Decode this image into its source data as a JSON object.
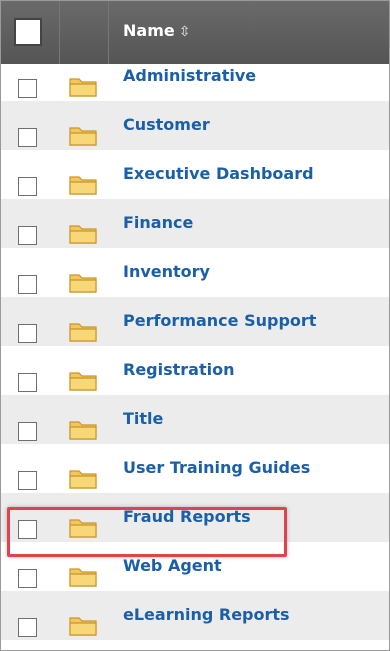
{
  "header": {
    "name_label": "Name",
    "sort_symbol": "⇳"
  },
  "folders": [
    {
      "label": "Administrative"
    },
    {
      "label": "Customer"
    },
    {
      "label": "Executive Dashboard"
    },
    {
      "label": "Finance"
    },
    {
      "label": "Inventory"
    },
    {
      "label": "Performance Support"
    },
    {
      "label": "Registration"
    },
    {
      "label": "Title"
    },
    {
      "label": "User Training Guides"
    },
    {
      "label": "Fraud Reports"
    },
    {
      "label": "Web Agent"
    },
    {
      "label": "eLearning Reports"
    }
  ],
  "colors": {
    "link": "#1b5fa8",
    "header_bg": "#5e5e5e",
    "alt_row": "#ececec",
    "highlight": "#e0434a",
    "folder": "#f3c75d"
  },
  "icons": {
    "folder": "folder-icon",
    "checkbox": "checkbox-icon",
    "sort": "sort-icon"
  }
}
